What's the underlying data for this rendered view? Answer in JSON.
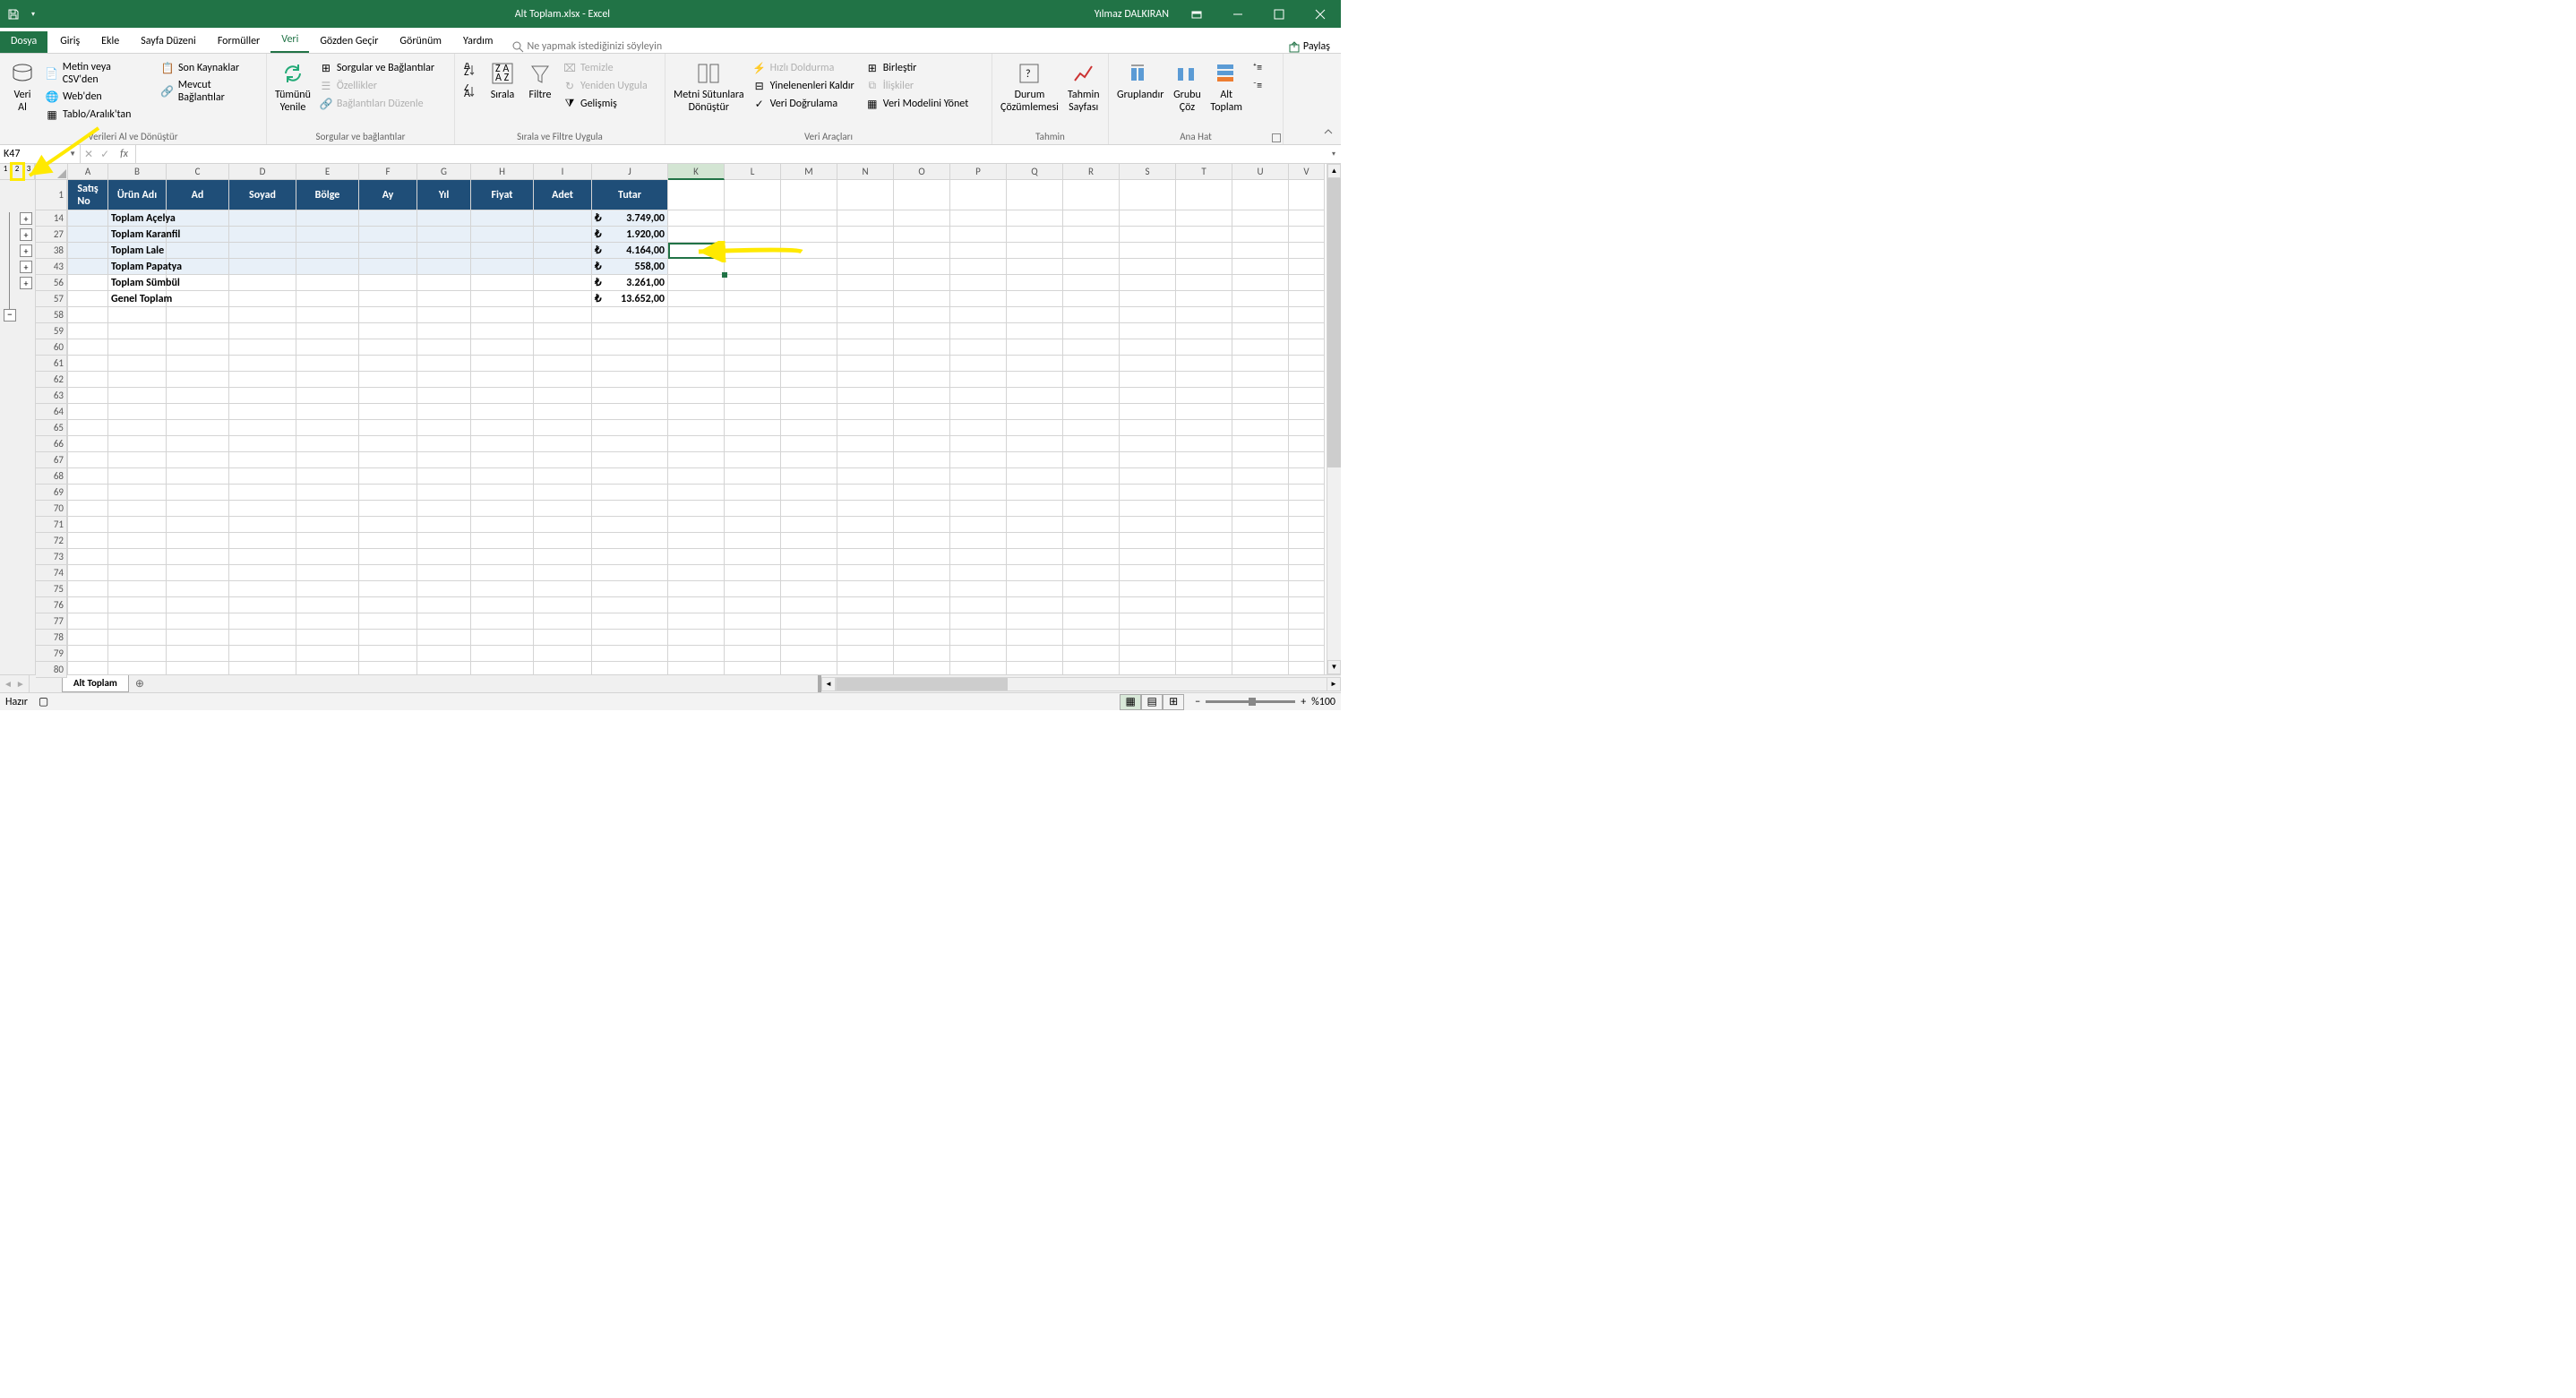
{
  "titlebar": {
    "filename": "Alt Toplam.xlsx  -  Excel",
    "username": "Yılmaz DALKIRAN"
  },
  "tabs": {
    "file": "Dosya",
    "items": [
      "Giriş",
      "Ekle",
      "Sayfa Düzeni",
      "Formüller",
      "Veri",
      "Gözden Geçir",
      "Görünüm",
      "Yardım"
    ],
    "active": "Veri",
    "tellme": "Ne yapmak istediğinizi söyleyin",
    "share": "Paylaş"
  },
  "ribbon": {
    "g1": {
      "big": "Veri\nAl",
      "r1": "Metin veya CSV'den",
      "r2": "Web'den",
      "r3": "Tablo/Aralık'tan",
      "r4": "Son Kaynaklar",
      "r5": "Mevcut Bağlantılar",
      "label": "Verileri Al ve Dönüştür"
    },
    "g2": {
      "big": "Tümünü\nYenile",
      "r1": "Sorgular ve Bağlantılar",
      "r2": "Özellikler",
      "r3": "Bağlantıları Düzenle",
      "label": "Sorgular ve bağlantılar"
    },
    "g3": {
      "big1": "Sırala",
      "big2": "Filtre",
      "r1": "Temizle",
      "r2": "Yeniden Uygula",
      "r3": "Gelişmiş",
      "label": "Sırala ve Filtre Uygula"
    },
    "g4": {
      "big": "Metni Sütunlara\nDönüştür",
      "r1": "Hızlı Doldurma",
      "r2": "Yinelenenleri Kaldır",
      "r3": "Veri Doğrulama",
      "r4": "Birleştir",
      "r5": "İlişkiler",
      "r6": "Veri Modelini Yönet",
      "label": "Veri Araçları"
    },
    "g5": {
      "big1": "Durum\nÇözümlemesi",
      "big2": "Tahmin\nSayfası",
      "label": "Tahmin"
    },
    "g6": {
      "big1": "Gruplandır",
      "big2": "Grubu\nÇöz",
      "big3": "Alt\nToplam",
      "label": "Ana Hat"
    }
  },
  "namebox": "K47",
  "columns": [
    "A",
    "B",
    "C",
    "D",
    "E",
    "F",
    "G",
    "H",
    "I",
    "J",
    "K",
    "L",
    "M",
    "N",
    "O",
    "P",
    "Q",
    "R",
    "S",
    "T",
    "U",
    "V"
  ],
  "headerRow": {
    "A": "Satış\nNo",
    "B": "Ürün Adı",
    "C": "Ad",
    "D": "Soyad",
    "E": "Bölge",
    "F": "Ay",
    "G": "Yıl",
    "H": "Fiyat",
    "I": "Adet",
    "J": "Tutar"
  },
  "dataRows": [
    {
      "rh": "14",
      "b": "Toplam Açelya",
      "j": "3.749,00",
      "sub": true
    },
    {
      "rh": "27",
      "b": "Toplam Karanfil",
      "j": "1.920,00",
      "sub": true
    },
    {
      "rh": "38",
      "b": "Toplam Lale",
      "j": "4.164,00",
      "sub": true
    },
    {
      "rh": "43",
      "b": "Toplam Papatya",
      "j": "558,00",
      "sub": true
    },
    {
      "rh": "56",
      "b": "Toplam Sümbül",
      "j": "3.261,00",
      "sub": false
    },
    {
      "rh": "57",
      "b": "Genel Toplam",
      "j": "13.652,00",
      "sub": false
    }
  ],
  "emptyRows": [
    "58",
    "59",
    "60",
    "61",
    "62",
    "63",
    "64",
    "65",
    "66",
    "67",
    "68",
    "69",
    "70",
    "71",
    "72",
    "73",
    "74",
    "75",
    "76",
    "77",
    "78",
    "79",
    "80"
  ],
  "currency": "₺",
  "sheet_tab": "Alt Toplam",
  "status": "Hazır",
  "zoom": "%100",
  "chart_data": {
    "type": "table",
    "headers": [
      "Satış No",
      "Ürün Adı",
      "Ad",
      "Soyad",
      "Bölge",
      "Ay",
      "Yıl",
      "Fiyat",
      "Adet",
      "Tutar"
    ],
    "rows": [
      [
        "14",
        "Toplam Açelya",
        "",
        "",
        "",
        "",
        "",
        "",
        "",
        "₺ 3.749,00"
      ],
      [
        "27",
        "Toplam Karanfil",
        "",
        "",
        "",
        "",
        "",
        "",
        "",
        "₺ 1.920,00"
      ],
      [
        "38",
        "Toplam Lale",
        "",
        "",
        "",
        "",
        "",
        "",
        "",
        "₺ 4.164,00"
      ],
      [
        "43",
        "Toplam Papatya",
        "",
        "",
        "",
        "",
        "",
        "",
        "",
        "₺ 558,00"
      ],
      [
        "56",
        "Toplam Sümbül",
        "",
        "",
        "",
        "",
        "",
        "",
        "",
        "₺ 3.261,00"
      ],
      [
        "57",
        "Genel Toplam",
        "",
        "",
        "",
        "",
        "",
        "",
        "",
        "₺ 13.652,00"
      ]
    ]
  }
}
